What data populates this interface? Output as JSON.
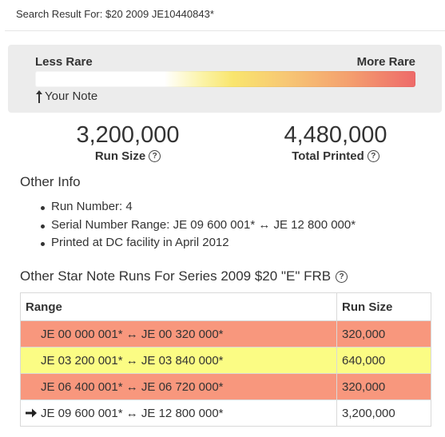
{
  "search": {
    "label": "Search Result For: $20 2009 JE10440843*"
  },
  "rarity": {
    "less_label": "Less Rare",
    "more_label": "More Rare",
    "your_note_label": "Your Note",
    "colors": {
      "low": "#ffffff",
      "mid": "#f9e56e",
      "high": "#ee6a6a"
    }
  },
  "stats": {
    "run_size": {
      "value": "3,200,000",
      "label": "Run Size"
    },
    "total_printed": {
      "value": "4,480,000",
      "label": "Total Printed"
    }
  },
  "other_info": {
    "title": "Other Info",
    "items": [
      "Run Number: 4",
      "Serial Number Range: JE 09 600 001* ↔ JE 12 800 000*",
      "Printed at DC facility in April 2012"
    ]
  },
  "runs": {
    "title": "Other Star Note Runs For Series 2009 $20 \"E\" FRB",
    "headers": {
      "range": "Range",
      "run_size": "Run Size"
    },
    "rows": [
      {
        "range": "JE 00 000 001* ↔ JE 00 320 000*",
        "run_size": "320,000",
        "rarity": "high",
        "current": false
      },
      {
        "range": "JE 03 200 001* ↔ JE 03 840 000*",
        "run_size": "640,000",
        "rarity": "mid",
        "current": false
      },
      {
        "range": "JE 06 400 001* ↔ JE 06 720 000*",
        "run_size": "320,000",
        "rarity": "high",
        "current": false
      },
      {
        "range": "JE 09 600 001* ↔ JE 12 800 000*",
        "run_size": "3,200,000",
        "rarity": "none",
        "current": true
      }
    ],
    "row_colors": {
      "high": "#f8977d",
      "mid": "#fbfc84",
      "none": "#ffffff"
    }
  }
}
